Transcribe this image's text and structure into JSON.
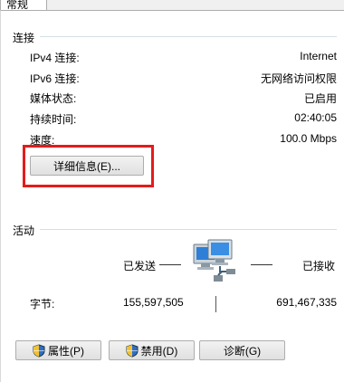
{
  "tab_label": "常规",
  "connection": {
    "title": "连接",
    "rows": [
      {
        "label": "IPv4 连接:",
        "value": "Internet"
      },
      {
        "label": "IPv6 连接:",
        "value": "无网络访问权限"
      },
      {
        "label": "媒体状态:",
        "value": "已启用"
      },
      {
        "label": "持续时间:",
        "value": "02:40:05"
      },
      {
        "label": "速度:",
        "value": "100.0 Mbps"
      }
    ],
    "details_button": "详细信息(E)..."
  },
  "activity": {
    "title": "活动",
    "sent_label": "已发送",
    "received_label": "已接收",
    "bytes_label": "字节:",
    "bytes_sent": "155,597,505",
    "bytes_received": "691,467,335"
  },
  "buttons": {
    "properties": "属性(P)",
    "disable": "禁用(D)",
    "diagnose": "诊断(G)"
  },
  "colors": {
    "highlight": "#e41b1b",
    "monitor_screen": "#2f7fd6"
  }
}
